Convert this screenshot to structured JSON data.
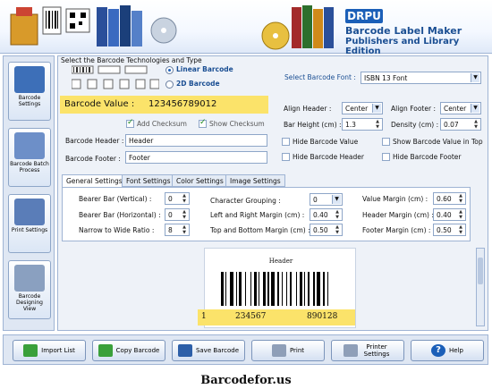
{
  "brand": {
    "badge": "DRPU",
    "title": "Barcode Label Maker",
    "subtitle": "Publishers and Library Edition"
  },
  "sidebar": {
    "items": [
      {
        "label": "Barcode Settings"
      },
      {
        "label": "Barcode Batch Process"
      },
      {
        "label": "Print Settings"
      },
      {
        "label": "Barcode Designing View"
      }
    ]
  },
  "tech": {
    "heading": "Select the Barcode Technologies and Type",
    "linear": "Linear Barcode",
    "twod": "2D Barcode",
    "font_label": "Select Barcode Font :",
    "font_value": "ISBN 13 Font"
  },
  "form": {
    "value_label": "Barcode Value :",
    "value": "123456789012",
    "add_checksum": "Add Checksum",
    "show_checksum": "Show Checksum",
    "header_label": "Barcode Header :",
    "header_value": "Header",
    "footer_label": "Barcode Footer :",
    "footer_value": "Footer",
    "align_header_label": "Align Header :",
    "align_header_value": "Center",
    "align_footer_label": "Align Footer :",
    "align_footer_value": "Center",
    "bar_height_label": "Bar Height (cm) :",
    "bar_height_value": "1.3",
    "density_label": "Density (cm) :",
    "density_value": "0.07",
    "hide_value": "Hide Barcode Value",
    "show_value_top": "Show Barcode Value in Top",
    "hide_header": "Hide Barcode Header",
    "hide_footer": "Hide Barcode Footer"
  },
  "tabs": [
    "General Settings",
    "Font Settings",
    "Color Settings",
    "Image Settings"
  ],
  "general": {
    "bearer_v_label": "Bearer Bar (Vertical) :",
    "bearer_v": "0",
    "bearer_h_label": "Bearer Bar (Horizontal) :",
    "bearer_h": "0",
    "narrow_label": "Narrow to Wide Ratio :",
    "narrow": "8",
    "grouping_label": "Character Grouping :",
    "grouping": "0",
    "lr_margin_label": "Left and Right Margin (cm) :",
    "lr_margin": "0.40",
    "tb_margin_label": "Top and Bottom Margin (cm) :",
    "tb_margin": "0.50",
    "value_margin_label": "Value Margin (cm) :",
    "value_margin": "0.60",
    "header_margin_label": "Header Margin (cm) :",
    "header_margin": "0.40",
    "footer_margin_label": "Footer Margin (cm) :",
    "footer_margin": "0.50"
  },
  "preview": {
    "header": "Header",
    "digit_first": "1",
    "digits_left": "234567",
    "digits_right": "890128"
  },
  "toolbar": {
    "import": "Import List",
    "copy": "Copy Barcode",
    "save": "Save Barcode",
    "print": "Print",
    "printer": "Printer Settings",
    "help": "Help"
  },
  "footer": "Barcodefor.us",
  "colors": {
    "accent": "#1b5fb8",
    "highlight": "#fbe36a",
    "panel": "#eef2f8"
  }
}
